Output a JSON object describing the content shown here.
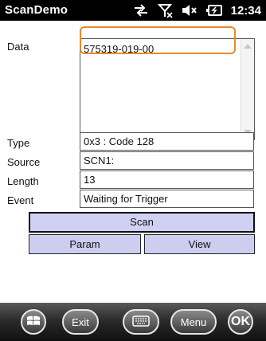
{
  "title_bar": {
    "app_title": "ScanDemo",
    "time": "12:34",
    "status_icons": [
      "data-sync-icon",
      "signal-off-icon",
      "volume-muted-icon",
      "battery-charging-icon"
    ]
  },
  "form": {
    "data_label": "Data",
    "data_value": "575319-019-00",
    "type_label": "Type",
    "type_value": "0x3 : Code 128",
    "source_label": "Source",
    "source_value": "SCN1:",
    "length_label": "Length",
    "length_value": "13",
    "event_label": "Event",
    "event_value": "Waiting for Trigger"
  },
  "buttons": {
    "scan": "Scan",
    "param": "Param",
    "view": "View"
  },
  "softbar": {
    "exit": "Exit",
    "menu": "Menu",
    "ok": "OK",
    "icons": [
      "windows-start-icon",
      "keyboard-icon"
    ]
  },
  "colors": {
    "highlight": "#e88a2c",
    "button_fill": "#cdcdf0"
  }
}
